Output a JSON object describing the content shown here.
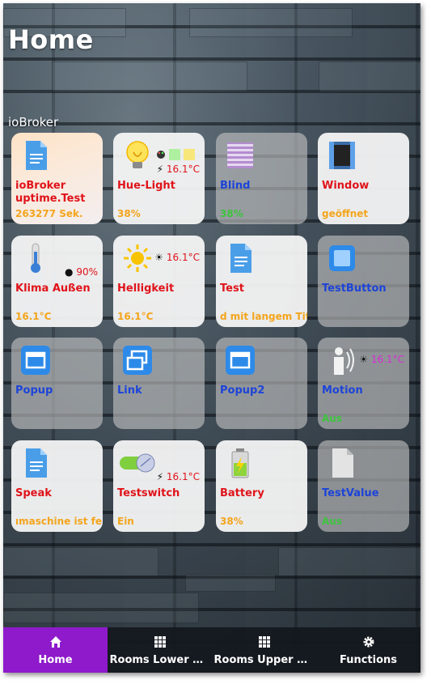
{
  "header": {
    "title": "Home"
  },
  "section": {
    "label": "ioBroker"
  },
  "tiles": [
    {
      "name": "ioBroker uptime.Test",
      "value": "263277 Sek.",
      "icon": "document-icon"
    },
    {
      "name": "Hue-Light",
      "value": "38%",
      "extra": "16.1°C",
      "extra_glyph": "⚡",
      "icon": "lightbulb-icon"
    },
    {
      "name": "Blind",
      "value": "38%",
      "icon": "blind-icon"
    },
    {
      "name": "Window",
      "value": "geöffnet",
      "icon": "window-icon"
    },
    {
      "name": "Klima Außen",
      "value": "16.1°C",
      "extra": "90%",
      "extra_glyph": "💧",
      "icon": "thermometer-icon"
    },
    {
      "name": "Helligkeit",
      "value": "16.1°C",
      "extra": "16.1°C",
      "extra_glyph": "☀",
      "icon": "sun-icon"
    },
    {
      "name": "Test",
      "value": "d mit langem Tite",
      "icon": "document-icon"
    },
    {
      "name": "TestButton",
      "value": "",
      "icon": "button-icon"
    },
    {
      "name": "Popup",
      "value": "",
      "icon": "popup-icon"
    },
    {
      "name": "Link",
      "value": "",
      "icon": "link-icon"
    },
    {
      "name": "Popup2",
      "value": "",
      "icon": "popup-icon"
    },
    {
      "name": "Motion",
      "value": "Aus",
      "extra": "16.1°C",
      "extra_glyph": "☀",
      "icon": "motion-icon"
    },
    {
      "name": "Speak",
      "value": "ımaschine ist fert",
      "icon": "document-icon"
    },
    {
      "name": "Testswitch",
      "value": "Ein",
      "extra": "16.1°C",
      "extra_glyph": "⚡",
      "icon": "switch-icon"
    },
    {
      "name": "Battery",
      "value": "38%",
      "icon": "battery-icon"
    },
    {
      "name": "TestValue",
      "value": "Aus",
      "icon": "file-icon"
    }
  ],
  "nav": [
    {
      "label": "Home",
      "icon": "home-icon"
    },
    {
      "label": "Rooms Lower Fl...",
      "icon": "grid-icon"
    },
    {
      "label": "Rooms Upper Fl...",
      "icon": "grid-icon"
    },
    {
      "label": "Functions",
      "icon": "gear-icon"
    }
  ],
  "colors": {
    "name_red": "#e0131a",
    "name_blue": "#1d44d8",
    "value_orange": "#f3a51c",
    "value_green": "#3dc43d",
    "nav_active": "#8e1acb"
  }
}
